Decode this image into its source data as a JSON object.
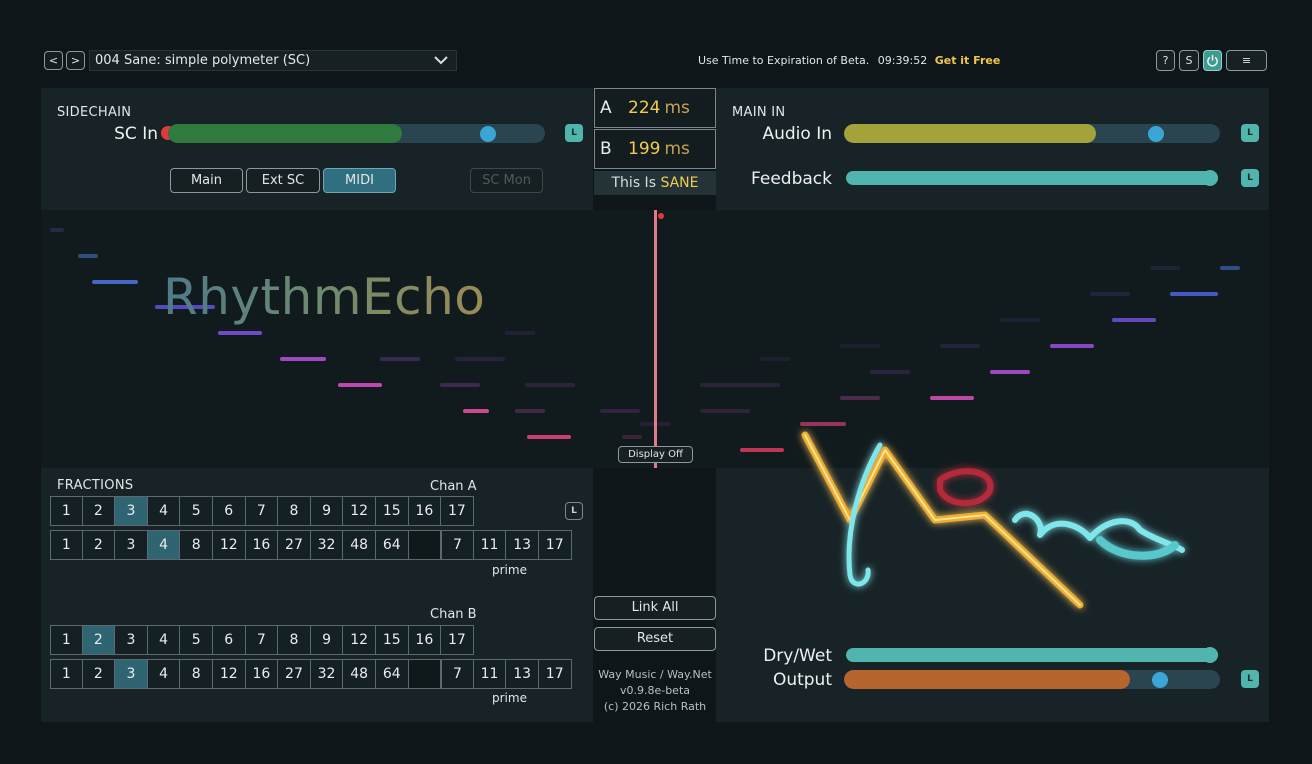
{
  "topbar": {
    "prev_label": "<",
    "next_label": ">",
    "preset_name": "004  Sane: simple polymeter (SC)",
    "beta_text": "Use Time to Expiration of Beta.",
    "beta_timer": "09:39:52",
    "beta_link": "Get it Free",
    "help_label": "?",
    "s_label": "S",
    "power_icon": "power-icon",
    "menu_icon": "menu-icon",
    "menu_glyph": "≡"
  },
  "sidechain": {
    "title": "SIDECHAIN",
    "sc_in_label": "SC In",
    "sc_in_level": 0.85,
    "sc_in_meter": 0.62,
    "l_label": "L",
    "modes": [
      "Main",
      "Ext SC",
      "MIDI"
    ],
    "active_mode": "MIDI",
    "sc_mon_label": "SC Mon"
  },
  "delays": {
    "a_label": "A",
    "a_value": "224",
    "b_label": "B",
    "b_value": "199",
    "unit": "ms",
    "status_prefix": "This Is",
    "status_value": "SANE"
  },
  "main_in": {
    "title": "MAIN IN",
    "audio_in_label": "Audio In",
    "audio_in_level": 0.83,
    "audio_in_meter": 0.67,
    "feedback_label": "Feedback",
    "feedback_level": 1.0,
    "l_label": "L"
  },
  "visualizer": {
    "logo_text": "RhythmEcho",
    "display_button": "Display Off",
    "playhead_color": "#e07a88"
  },
  "fractions": {
    "title": "FRACTIONS",
    "chan_a_label": "Chan A",
    "chan_b_label": "Chan B",
    "prime_label": "prime",
    "l_label": "L",
    "row1": [
      "1",
      "2",
      "3",
      "4",
      "5",
      "6",
      "7",
      "8",
      "9",
      "12",
      "15",
      "16",
      "17"
    ],
    "row2": [
      "1",
      "2",
      "3",
      "4",
      "8",
      "12",
      "16",
      "27",
      "32",
      "48",
      "64",
      "",
      "7",
      "11",
      "13",
      "17"
    ],
    "chan_a_row1_active": "3",
    "chan_a_row2_active": "4",
    "chan_b_row1_active": "2",
    "chan_b_row2_active": "3"
  },
  "actions": {
    "link_all": "Link All",
    "reset": "Reset",
    "credit_line1": "Way Music / Way.Net",
    "credit_line2": "v0.9.8e-beta",
    "credit_line3": "(c) 2026 Rich Rath"
  },
  "output": {
    "dry_wet_label": "Dry/Wet",
    "dry_wet_level": 1.0,
    "output_label": "Output",
    "output_level": 0.84,
    "output_meter": 0.76,
    "l_label": "L",
    "brand_logo": "Way Music"
  },
  "colors": {
    "accent_teal": "#4fb5ad",
    "knob_blue": "#3aa6d6",
    "sc_meter_green": "#2f7a3c",
    "audio_meter_olive": "#a3a33a",
    "output_meter_orange": "#b8642e",
    "delay_value_yellow": "#f3cc4d"
  }
}
